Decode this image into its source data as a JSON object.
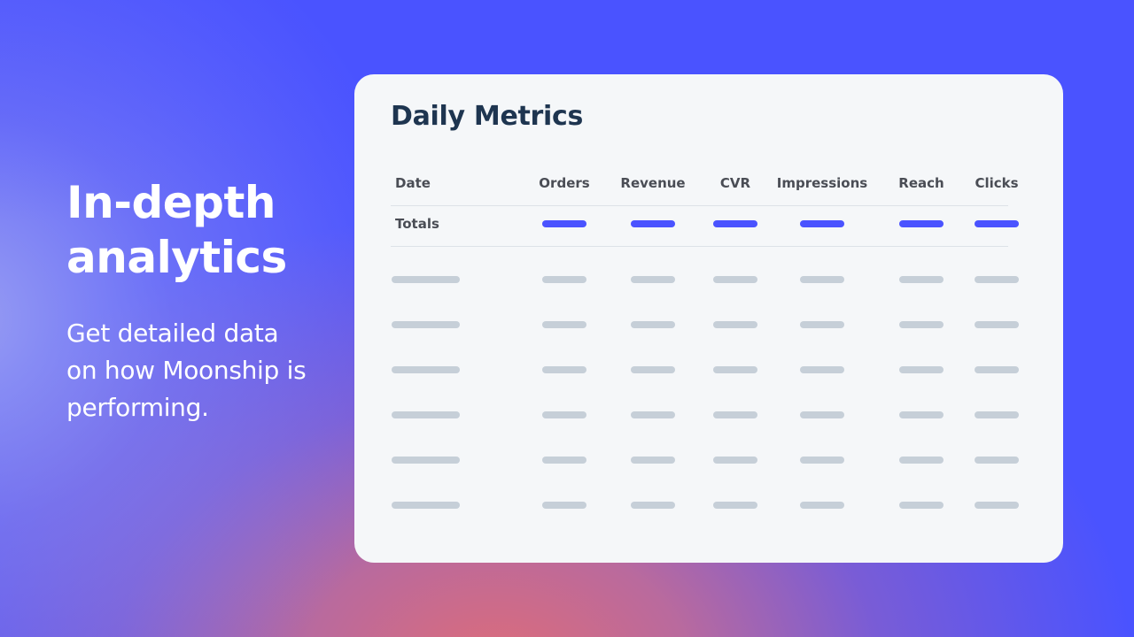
{
  "hero": {
    "title_line1": "In-depth",
    "title_line2": "analytics",
    "subtitle_line1": "Get detailed data",
    "subtitle_line2": "on how Moonship is",
    "subtitle_line3": "performing."
  },
  "card": {
    "title": "Daily Metrics",
    "columns": [
      "Date",
      "Orders",
      "Revenue",
      "CVR",
      "Impressions",
      "Reach",
      "Clicks"
    ],
    "totals_label": "Totals",
    "placeholder_rows": 6
  },
  "colors": {
    "background": "#4a53ff",
    "accent": "#4a53ff",
    "title": "#1e3550",
    "skeleton": "#c6cfd8",
    "card": "#f5f7f9"
  }
}
